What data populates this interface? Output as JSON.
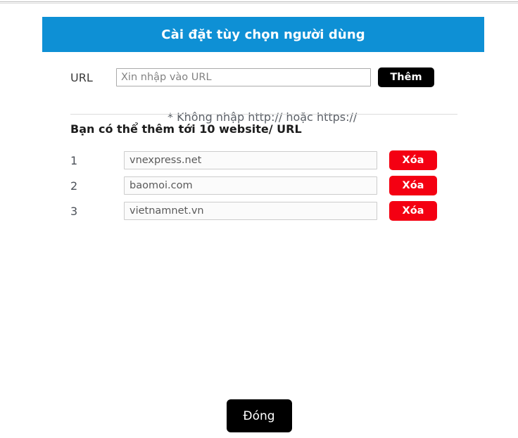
{
  "page": {
    "background_color": "#ffffff"
  },
  "panel": {
    "header": {
      "title": "Cài đặt tùy chọn người dùng",
      "background_color": "#0e90d5",
      "text_color": "#ffffff"
    },
    "url_form": {
      "label": "URL",
      "input_value": "",
      "input_placeholder": "Xin nhập vào URL",
      "add_button_label": "Thêm",
      "add_button_color": "#000000"
    },
    "hint": "* Không nhập http:// hoặc https://",
    "subheading": "Bạn có thể thêm tới 10 website/ URL",
    "list": {
      "delete_button_color": "#f40012",
      "items": [
        {
          "index": "1",
          "value": "vnexpress.net",
          "delete_label": "Xóa"
        },
        {
          "index": "2",
          "value": "baomoi.com",
          "delete_label": "Xóa"
        },
        {
          "index": "3",
          "value": "vietnamnet.vn",
          "delete_label": "Xóa"
        }
      ]
    }
  },
  "footer": {
    "close_button_label": "Đóng",
    "close_button_color": "#000000"
  }
}
